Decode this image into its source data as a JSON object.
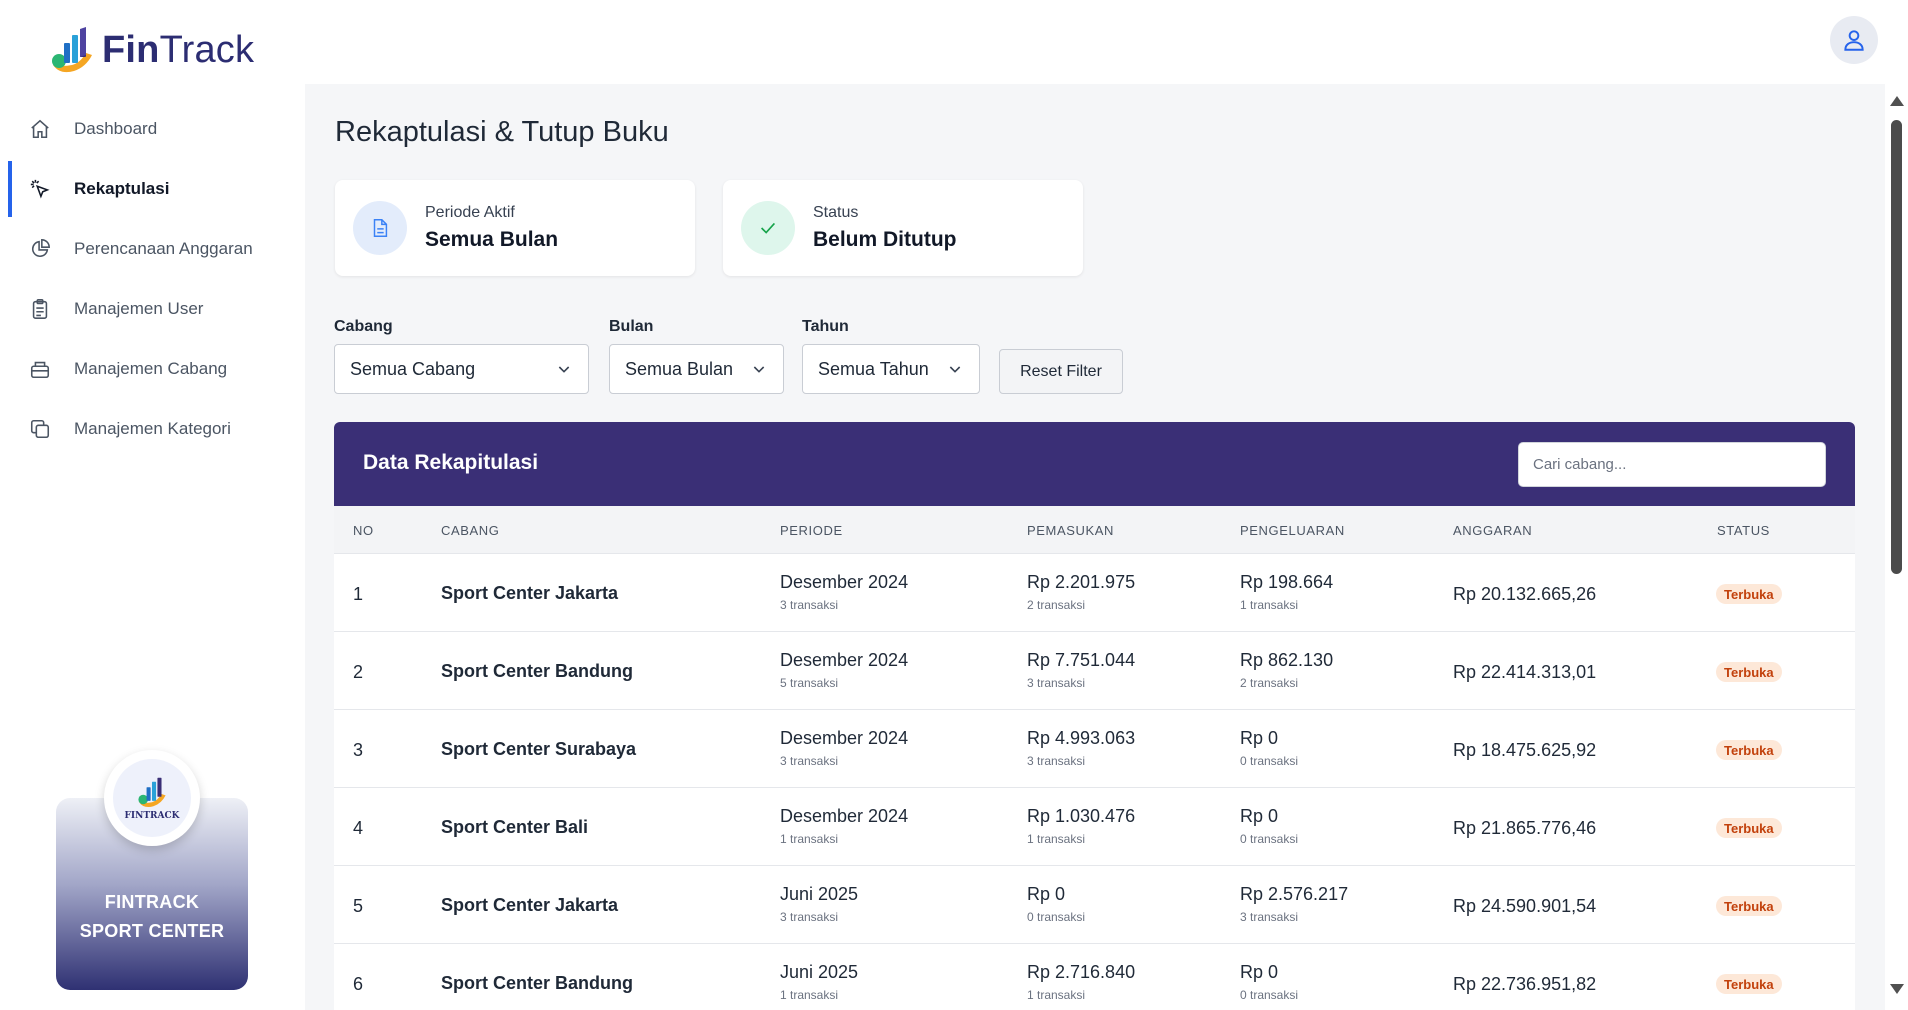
{
  "brand": {
    "name_bold": "Fin",
    "name_thin": "Track"
  },
  "user": {
    "icon": "user-icon"
  },
  "sidebar": {
    "items": [
      {
        "label": "Dashboard",
        "icon": "home-icon",
        "active": false
      },
      {
        "label": "Rekaptulasi",
        "icon": "cursor-click-icon",
        "active": true
      },
      {
        "label": "Perencanaan Anggaran",
        "icon": "pie-chart-icon",
        "active": false
      },
      {
        "label": "Manajemen User",
        "icon": "clipboard-icon",
        "active": false
      },
      {
        "label": "Manajemen Cabang",
        "icon": "briefcase-icon",
        "active": false
      },
      {
        "label": "Manajemen Kategori",
        "icon": "copy-icon",
        "active": false
      }
    ],
    "promo": {
      "logo_text": "FINTRACK",
      "line1": "FINTRACK",
      "line2": "SPORT CENTER"
    }
  },
  "page": {
    "title": "Rekaptulasi & Tutup Buku",
    "cards": {
      "periode": {
        "label": "Periode Aktif",
        "value": "Semua Bulan"
      },
      "status": {
        "label": "Status",
        "value": "Belum Ditutup"
      }
    },
    "filters": {
      "cabang": {
        "label": "Cabang",
        "value": "Semua Cabang"
      },
      "bulan": {
        "label": "Bulan",
        "value": "Semua Bulan"
      },
      "tahun": {
        "label": "Tahun",
        "value": "Semua Tahun"
      },
      "reset_label": "Reset Filter"
    },
    "table": {
      "title": "Data Rekapitulasi",
      "search_placeholder": "Cari cabang...",
      "columns": [
        "NO",
        "CABANG",
        "PERIODE",
        "PEMASUKAN",
        "PENGELUARAN",
        "ANGGARAN",
        "STATUS"
      ],
      "rows": [
        {
          "no": "1",
          "cabang": "Sport Center Jakarta",
          "periode": "Desember 2024",
          "periode_sub": "3 transaksi",
          "pemasukan": "Rp 2.201.975",
          "pemasukan_sub": "2 transaksi",
          "pengeluaran": "Rp 198.664",
          "pengeluaran_sub": "1 transaksi",
          "anggaran": "Rp 20.132.665,26",
          "status": "Terbuka"
        },
        {
          "no": "2",
          "cabang": "Sport Center Bandung",
          "periode": "Desember 2024",
          "periode_sub": "5 transaksi",
          "pemasukan": "Rp 7.751.044",
          "pemasukan_sub": "3 transaksi",
          "pengeluaran": "Rp 862.130",
          "pengeluaran_sub": "2 transaksi",
          "anggaran": "Rp 22.414.313,01",
          "status": "Terbuka"
        },
        {
          "no": "3",
          "cabang": "Sport Center Surabaya",
          "periode": "Desember 2024",
          "periode_sub": "3 transaksi",
          "pemasukan": "Rp 4.993.063",
          "pemasukan_sub": "3 transaksi",
          "pengeluaran": "Rp 0",
          "pengeluaran_sub": "0 transaksi",
          "anggaran": "Rp 18.475.625,92",
          "status": "Terbuka"
        },
        {
          "no": "4",
          "cabang": "Sport Center Bali",
          "periode": "Desember 2024",
          "periode_sub": "1 transaksi",
          "pemasukan": "Rp 1.030.476",
          "pemasukan_sub": "1 transaksi",
          "pengeluaran": "Rp 0",
          "pengeluaran_sub": "0 transaksi",
          "anggaran": "Rp 21.865.776,46",
          "status": "Terbuka"
        },
        {
          "no": "5",
          "cabang": "Sport Center Jakarta",
          "periode": "Juni 2025",
          "periode_sub": "3 transaksi",
          "pemasukan": "Rp 0",
          "pemasukan_sub": "0 transaksi",
          "pengeluaran": "Rp 2.576.217",
          "pengeluaran_sub": "3 transaksi",
          "anggaran": "Rp 24.590.901,54",
          "status": "Terbuka"
        },
        {
          "no": "6",
          "cabang": "Sport Center Bandung",
          "periode": "Juni 2025",
          "periode_sub": "1 transaksi",
          "pemasukan": "Rp 2.716.840",
          "pemasukan_sub": "1 transaksi",
          "pengeluaran": "Rp 0",
          "pengeluaran_sub": "0 transaksi",
          "anggaran": "Rp 22.736.951,82",
          "status": "Terbuka"
        }
      ]
    }
  },
  "colors": {
    "accent": "#2563eb",
    "table_header": "#3a2f76",
    "brand": "#2c2d72",
    "badge_bg": "#fde8d8",
    "badge_text": "#c2410c"
  }
}
